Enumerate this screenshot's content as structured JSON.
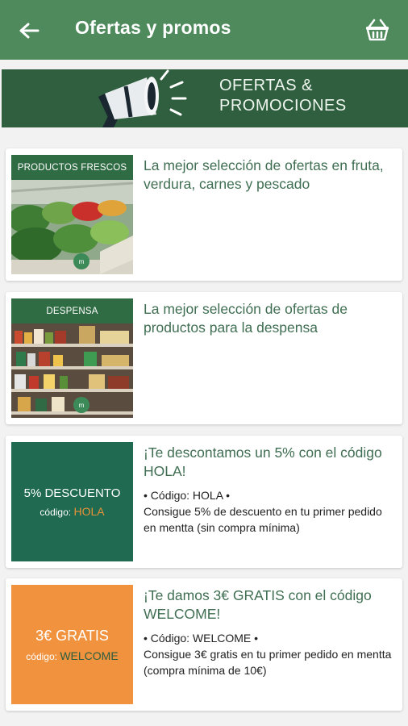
{
  "appbar": {
    "title": "Ofertas y promos",
    "color": "#4f8a5d"
  },
  "banner": {
    "line1": "OFERTAS &",
    "line2": "PROMOCIONES",
    "color": "#2f5f3e"
  },
  "cards": [
    {
      "label": "PRODUCTOS FRESCOS",
      "headline": "La mejor selección de ofertas en fruta, verdura, carnes y pescado",
      "logo": "m"
    },
    {
      "label": "DESPENSA",
      "headline": "La mejor selección de ofertas de productos para la despensa",
      "logo": "m"
    },
    {
      "box_title": "5% DESCUENTO",
      "box_code_label": "código:",
      "box_code_value": "HOLA",
      "box_color": "#1f6a50",
      "headline": "¡Te descontamos un 5% con el código HOLA!",
      "code_line": "• Código: HOLA •",
      "description": "Consigue 5% de descuento en tu primer pedido en mentta (sin compra mínima)"
    },
    {
      "box_title": "3€ GRATIS",
      "box_code_label": "código:",
      "box_code_value": "WELCOME",
      "box_color": "#f0923e",
      "headline": "¡Te damos 3€ GRATIS con el código WELCOME!",
      "code_line": "• Código: WELCOME •",
      "description": "Consigue 3€ gratis en tu primer pedido en mentta (compra mínima de 10€)"
    }
  ]
}
